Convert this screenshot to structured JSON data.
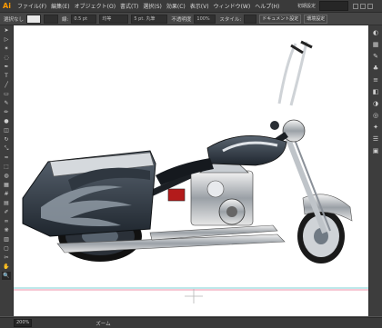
{
  "app": {
    "logo": "Ai",
    "accent": "#ff9a00"
  },
  "menu": {
    "items": [
      "ファイル(F)",
      "編集(E)",
      "オブジェクト(O)",
      "書式(T)",
      "選択(S)",
      "効果(C)",
      "表示(V)",
      "ウィンドウ(W)",
      "ヘルプ(H)"
    ]
  },
  "topright": {
    "workspace": "初期設定"
  },
  "control": {
    "selection_label": "選択なし",
    "stroke_label": "線:",
    "stroke_value": "0.5 pt",
    "brush_value": "均等",
    "point_value": "5 pt. 丸筆",
    "opacity_label": "不透明度",
    "opacity_value": "100%",
    "style_label": "スタイル:",
    "doc_settings": "ドキュメント設定",
    "prefs": "環境設定"
  },
  "status": {
    "zoom": "200%",
    "tool": "ズーム"
  },
  "toolbar": {
    "icons": [
      "selection-tool-icon",
      "direct-selection-tool-icon",
      "magic-wand-icon",
      "lasso-icon",
      "pen-icon",
      "type-icon",
      "line-icon",
      "rectangle-icon",
      "brush-icon",
      "pencil-icon",
      "blob-brush-icon",
      "eraser-icon",
      "rotate-icon",
      "scale-icon",
      "width-icon",
      "free-transform-icon",
      "shape-builder-icon",
      "perspective-icon",
      "mesh-icon",
      "gradient-icon",
      "eyedropper-icon",
      "blend-icon",
      "symbol-sprayer-icon",
      "graph-icon",
      "artboard-icon",
      "slice-icon",
      "hand-icon",
      "zoom-icon"
    ]
  },
  "panels": {
    "icons": [
      "color-panel-icon",
      "swatches-panel-icon",
      "brushes-panel-icon",
      "symbols-panel-icon",
      "stroke-panel-icon",
      "gradient-panel-icon",
      "transparency-panel-icon",
      "appearance-panel-icon",
      "graphic-styles-panel-icon",
      "layers-panel-icon",
      "artboards-panel-icon"
    ]
  }
}
